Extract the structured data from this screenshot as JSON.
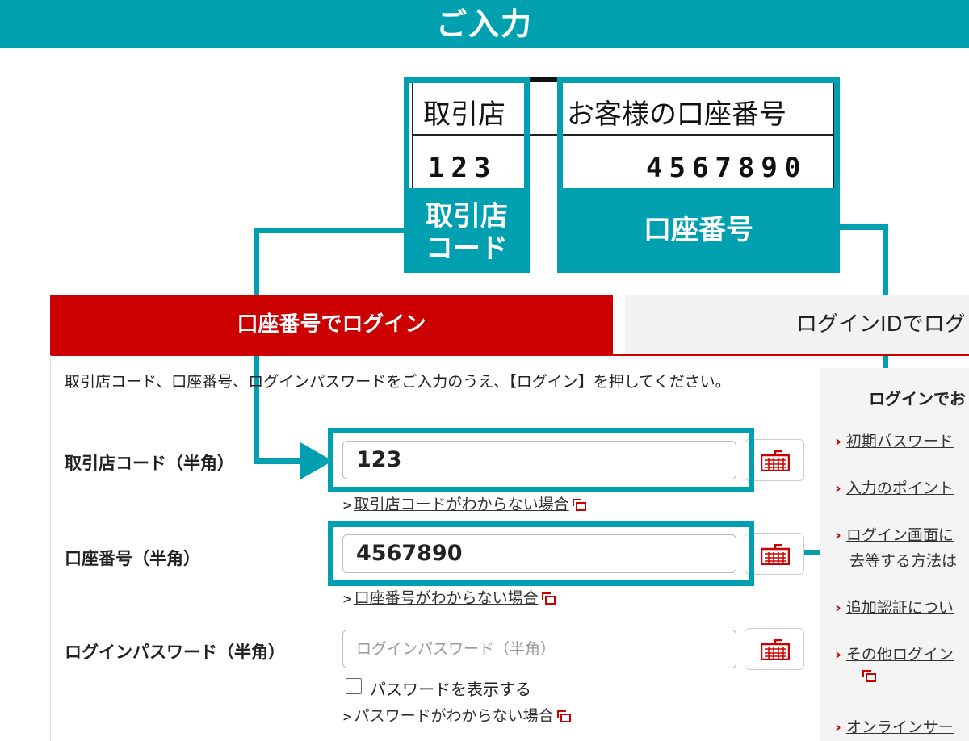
{
  "header": {
    "title": "ご入力"
  },
  "card": {
    "branch_head": "取引店",
    "branch_value": "123",
    "account_head": "お客様の口座番号",
    "account_value": "4567890"
  },
  "callouts": {
    "branch_label_line1": "取引店",
    "branch_label_line2": "コード",
    "account_label": "口座番号"
  },
  "tabs": {
    "active": "口座番号でログイン",
    "inactive": "ログインIDでログ"
  },
  "form": {
    "instruction": "取引店コード、口座番号、ログインパスワードをご入力のうえ、【ログイン】を押してください。",
    "branch_label": "取引店コード（半角）",
    "branch_value": "123",
    "branch_help": "取引店コードがわからない場合",
    "account_label": "口座番号（半角）",
    "account_value": "4567890",
    "account_help": "口座番号がわからない場合",
    "password_label": "ログインパスワード（半角）",
    "password_placeholder": "ログインパスワード（半角）",
    "show_password": "パスワードを表示する",
    "password_help": "パスワードがわからない場合"
  },
  "sidebar": {
    "title": "ログインでお",
    "links": [
      "初期パスワード",
      "入力のポイント",
      "ログイン画面に",
      "追加認証につい",
      "その他ログイン",
      "オンラインサー"
    ],
    "link3_line2": "去等する方法は"
  },
  "colors": {
    "teal": "#00a0b0",
    "red": "#cc0000"
  },
  "icons": [
    "keyboard-icon",
    "external-link-icon",
    "chevron-right-icon"
  ]
}
